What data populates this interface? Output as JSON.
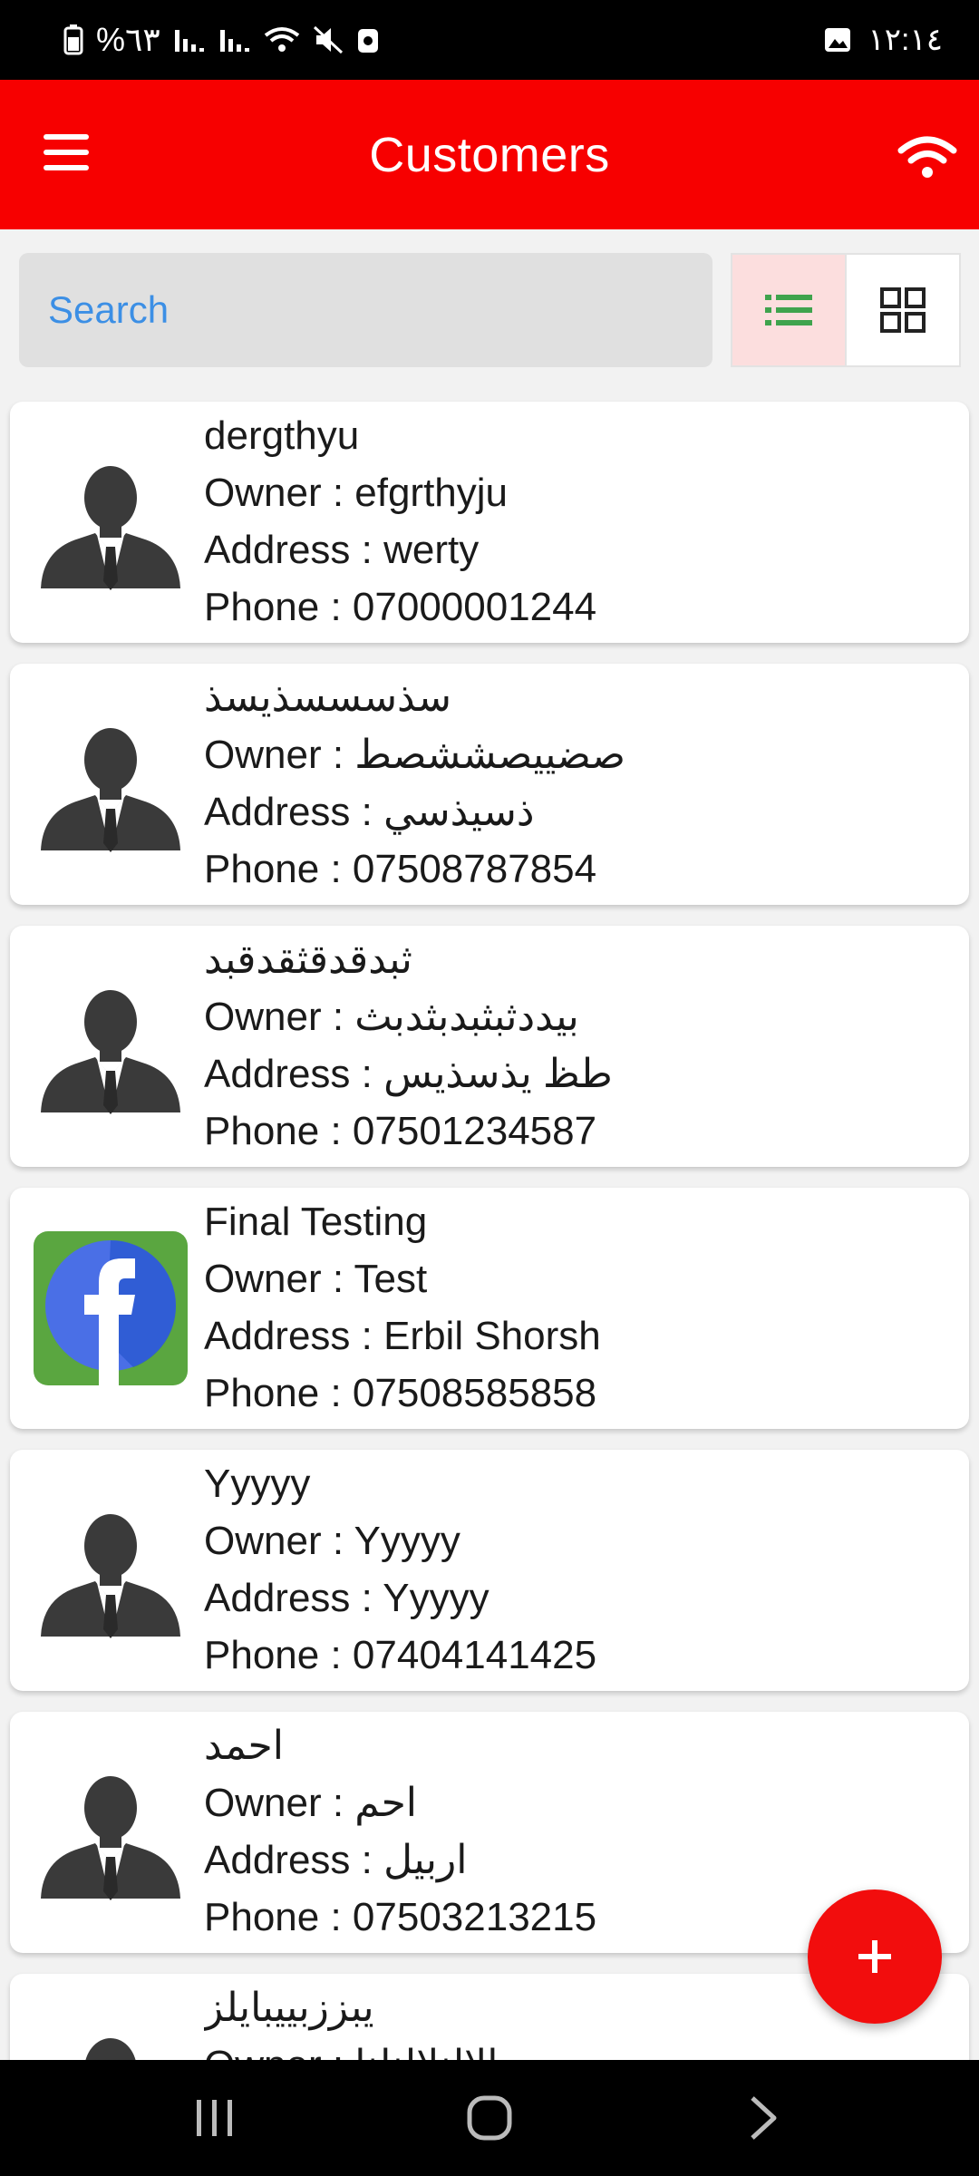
{
  "status_bar": {
    "battery_text": "%٦٣",
    "clock": "١٢:١٤"
  },
  "app_bar": {
    "title": "Customers"
  },
  "search": {
    "placeholder": "Search"
  },
  "colors": {
    "primary": "#f70000",
    "search_text": "#3c8fe5",
    "list_icon": "#3fa34d"
  },
  "customers": [
    {
      "name": "dergthyu",
      "owner": "Owner : efgrthyju",
      "address": "Address : werty",
      "phone": "Phone : 07000001244",
      "avatar": "person-silhouette-icon"
    },
    {
      "name": "سذسسسذيسذ",
      "owner": "Owner : صضييصششصط",
      "address": "Address : ذسيذسي",
      "phone": "Phone : 07508787854",
      "avatar": "person-silhouette-icon"
    },
    {
      "name": "ثبدقدقثقدقبد",
      "owner": "Owner : بيددثبثبدبثدبث",
      "address": "Address : طظ يذسذيس",
      "phone": "Phone : 07501234587",
      "avatar": "person-silhouette-icon"
    },
    {
      "name": "Final Testing",
      "owner": "Owner : Test",
      "address": "Address : Erbil  Shorsh",
      "phone": "Phone : 07508585858",
      "avatar": "facebook-logo-icon"
    },
    {
      "name": "Yyyyy",
      "owner": "Owner : Yyyyy",
      "address": "Address : Yyyyy",
      "phone": "Phone : 07404141425",
      "avatar": "person-silhouette-icon"
    },
    {
      "name": "احمد",
      "owner": "Owner : احم",
      "address": "Address : اربيل",
      "phone": "Phone : 07503213215",
      "avatar": "person-silhouette-icon"
    },
    {
      "name": "يبززبييبايلز",
      "owner": "Owner : يالالنلالنلنا",
      "address": "",
      "phone": "",
      "avatar": "person-silhouette-icon"
    }
  ]
}
